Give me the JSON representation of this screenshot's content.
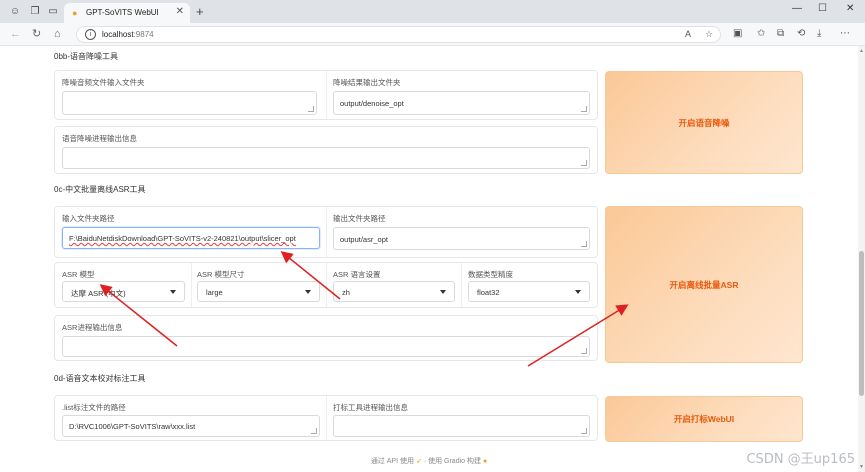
{
  "browser": {
    "tab_title": "GPT-SoVITS WebUI",
    "url_host": "localhost",
    "url_port": ":9874"
  },
  "denoise": {
    "section_title": "0bb-语音降噪工具",
    "input_label": "降噪音频文件输入文件夹",
    "input_value": "",
    "output_label": "降噪结果输出文件夹",
    "output_value": "output/denoise_opt",
    "info_label": "语音降噪进程输出信息",
    "button_label": "开启语音降噪"
  },
  "asr": {
    "section_title": "0c-中文批量离线ASR工具",
    "input_label": "输入文件夹路径",
    "input_value": "F:\\BaiduNetdiskDownload\\GPT-SoVITS-v2-240821\\output\\slicer_opt",
    "output_label": "输出文件夹路径",
    "output_value": "output/asr_opt",
    "model_label": "ASR 模型",
    "model_value": "达摩 ASR (中文)",
    "size_label": "ASR 模型尺寸",
    "size_value": "large",
    "lang_label": "ASR 语言设置",
    "lang_value": "zh",
    "precision_label": "数据类型精度",
    "precision_value": "float32",
    "info_label": "ASR进程输出信息",
    "button_label": "开启离线批量ASR"
  },
  "labeling": {
    "section_title": "0d-语音文本校对标注工具",
    "path_label": ".list标注文件的路径",
    "path_value": "D:\\RVC1006\\GPT-SoVITS\\raw\\xxx.list",
    "info_label": "打标工具进程输出信息",
    "button_label": "开启打标WebUI"
  },
  "footer": {
    "api_text": "通过 API 使用",
    "separator": "·",
    "gradio_text": "使用 Gradio 构建"
  },
  "watermark": "CSDN @王up165",
  "colors": {
    "accent": "#e8590c",
    "button_bg": "#fddcbc",
    "arrow": "#e02020"
  }
}
